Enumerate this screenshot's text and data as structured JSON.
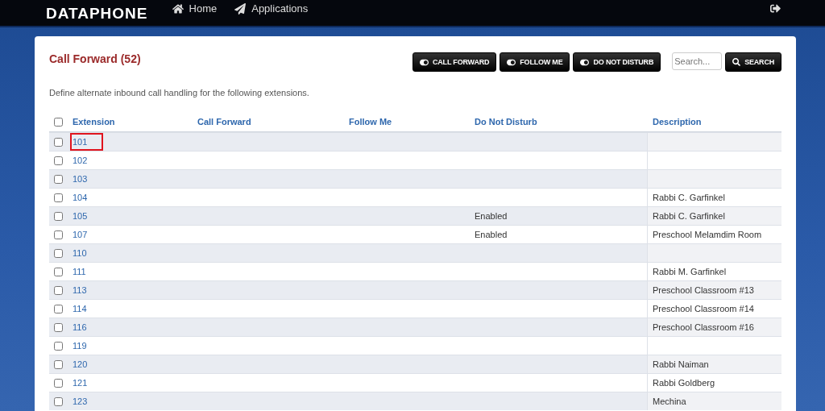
{
  "nav": {
    "brand": "DATAPHONE",
    "links": [
      {
        "label": "Home",
        "kind": "home"
      },
      {
        "label": "Applications",
        "kind": "apps"
      }
    ]
  },
  "page": {
    "title": "Call Forward (52)",
    "description": "Define alternate inbound call handling for the following extensions.",
    "actions": [
      "CALL FORWARD",
      "FOLLOW ME",
      "DO NOT DISTURB"
    ],
    "search": {
      "placeholder": "Search...",
      "button": "SEARCH"
    }
  },
  "table": {
    "columns": [
      "Extension",
      "Call Forward",
      "Follow Me",
      "Do Not Disturb",
      "Description"
    ],
    "all_checked": false,
    "rows": [
      {
        "extension": "101",
        "do_not_disturb": "",
        "description": "",
        "checked": false,
        "highlighted": true
      },
      {
        "extension": "102",
        "do_not_disturb": "",
        "description": "",
        "checked": false,
        "highlighted": false
      },
      {
        "extension": "103",
        "do_not_disturb": "",
        "description": "",
        "checked": false,
        "highlighted": false
      },
      {
        "extension": "104",
        "do_not_disturb": "",
        "description": "Rabbi C. Garfinkel",
        "checked": false,
        "highlighted": false
      },
      {
        "extension": "105",
        "do_not_disturb": "Enabled",
        "description": "Rabbi C. Garfinkel",
        "checked": false,
        "highlighted": false
      },
      {
        "extension": "107",
        "do_not_disturb": "Enabled",
        "description": "Preschool Melamdim Room",
        "checked": false,
        "highlighted": false
      },
      {
        "extension": "110",
        "do_not_disturb": "",
        "description": "",
        "checked": false,
        "highlighted": false
      },
      {
        "extension": "111",
        "do_not_disturb": "",
        "description": "Rabbi M. Garfinkel",
        "checked": false,
        "highlighted": false
      },
      {
        "extension": "113",
        "do_not_disturb": "",
        "description": "Preschool Classroom #13",
        "checked": false,
        "highlighted": false
      },
      {
        "extension": "114",
        "do_not_disturb": "",
        "description": "Preschool Classroom #14",
        "checked": false,
        "highlighted": false
      },
      {
        "extension": "116",
        "do_not_disturb": "",
        "description": "Preschool Classroom #16",
        "checked": false,
        "highlighted": false
      },
      {
        "extension": "119",
        "do_not_disturb": "",
        "description": "",
        "checked": false,
        "highlighted": false
      },
      {
        "extension": "120",
        "do_not_disturb": "",
        "description": "Rabbi Naiman",
        "checked": false,
        "highlighted": false
      },
      {
        "extension": "121",
        "do_not_disturb": "",
        "description": "Rabbi Goldberg",
        "checked": false,
        "highlighted": false
      },
      {
        "extension": "123",
        "do_not_disturb": "",
        "description": "Mechina",
        "checked": false,
        "highlighted": false
      }
    ]
  }
}
